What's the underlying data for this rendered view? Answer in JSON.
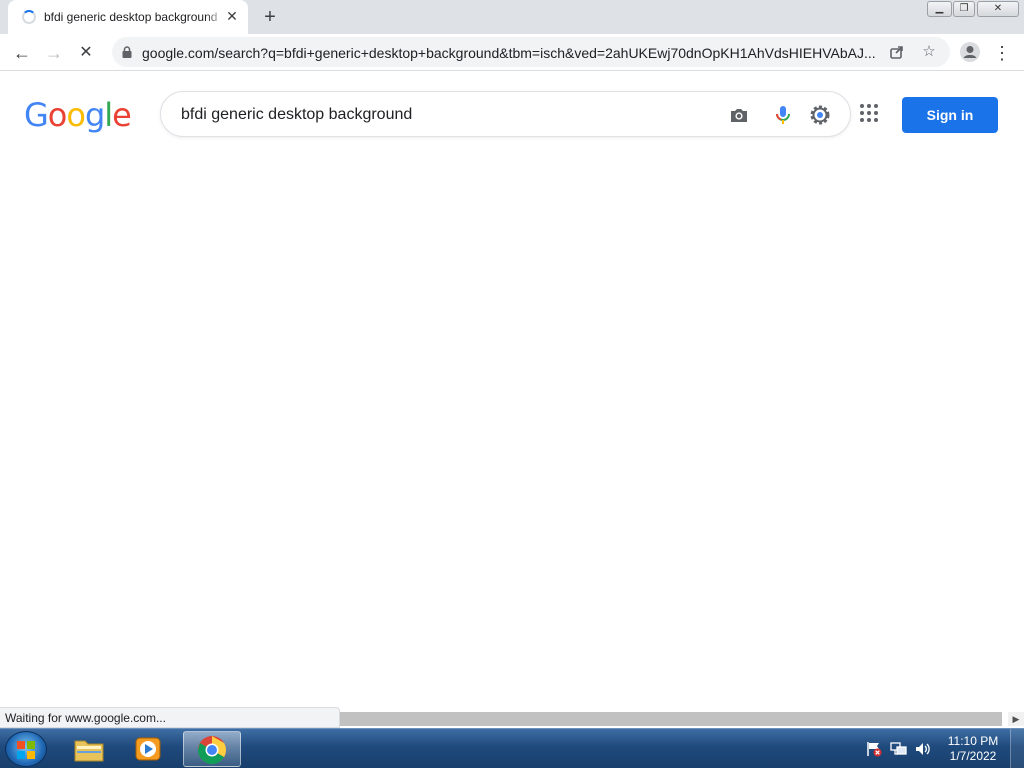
{
  "tab": {
    "title": "bfdi generic desktop background",
    "close": "✕"
  },
  "toolbar": {
    "url": "google.com/search?q=bfdi+generic+desktop+background&tbm=isch&ved=2ahUKEwj70dnOpKH1AhVdsHIEHVAbAJ...",
    "back": "←",
    "forward": "→",
    "stop": "✕",
    "menu": "⋮"
  },
  "page": {
    "logo": [
      "G",
      "o",
      "o",
      "g",
      "l",
      "e"
    ],
    "logo_colors": [
      "#4285f4",
      "#ea4335",
      "#fbbc05",
      "#4285f4",
      "#34a853",
      "#ea4335"
    ],
    "search_value": "bfdi generic desktop background",
    "signin_label": "Sign in"
  },
  "status": {
    "text": "Waiting for www.google.com..."
  },
  "taskbar": {
    "time": "11:10 PM",
    "date": "1/7/2022"
  },
  "colors": {
    "accent": "#1a73e8"
  }
}
